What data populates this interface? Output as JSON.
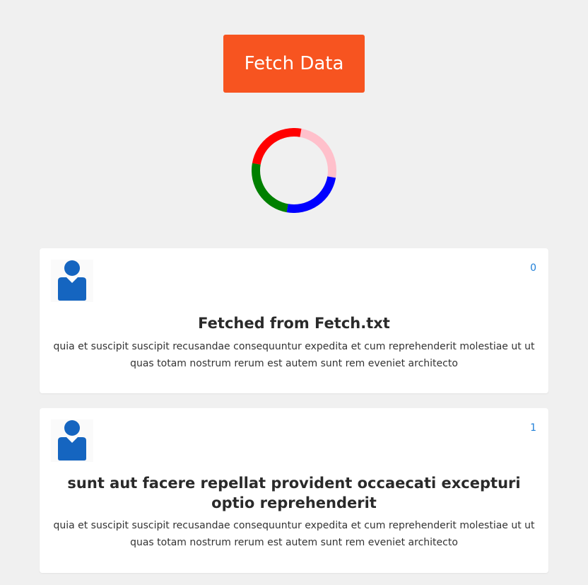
{
  "toolbar": {
    "fetch_label": "Fetch Data",
    "fetch_color": "#f75420"
  },
  "loader": {
    "icon": "loading-spinner-icon",
    "segment_colors": [
      "#ffc0cb",
      "#0000ff",
      "#008000",
      "#ff0000"
    ]
  },
  "posts": [
    {
      "id": "0",
      "avatar_icon": "user-avatar-icon",
      "title": "Fetched from Fetch.txt",
      "body": "quia et suscipit suscipit recusandae consequuntur expedita et cum reprehenderit molestiae ut ut quas totam nostrum rerum est autem sunt rem eveniet architecto"
    },
    {
      "id": "1",
      "avatar_icon": "user-avatar-icon",
      "title": "sunt aut facere repellat provident occaecati excepturi optio reprehenderit",
      "body": "quia et suscipit suscipit recusandae consequuntur expedita et cum reprehenderit molestiae ut ut quas totam nostrum rerum est autem sunt rem eveniet architecto"
    }
  ],
  "colors": {
    "background": "#f0f0f0",
    "card": "#ffffff",
    "id_link": "#1e7fd8",
    "avatar": "#1565c0"
  }
}
